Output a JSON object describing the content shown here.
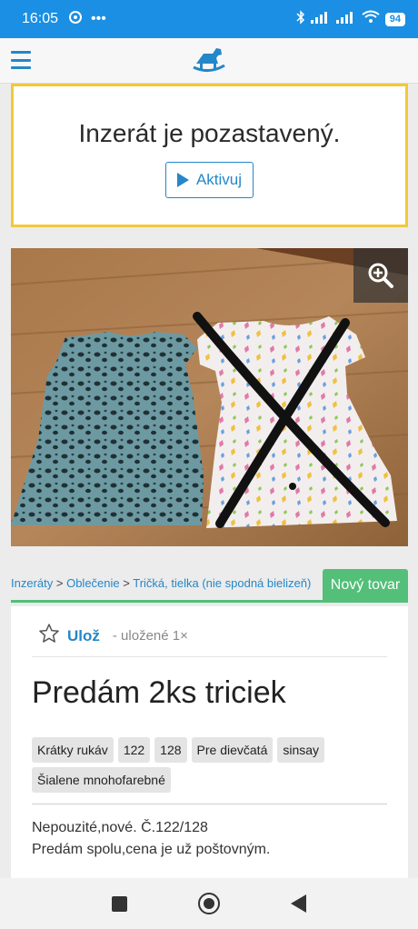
{
  "status_bar": {
    "time": "16:05",
    "battery": "94"
  },
  "paused": {
    "title": "Inzerát je pozastavený.",
    "activate_label": "Aktivuj"
  },
  "breadcrumb": {
    "items": [
      "Inzeráty",
      "Oblečenie",
      "Tričká, tielka (nie spodná bielizeň)"
    ],
    "separator": ">"
  },
  "badge": "Nový tovar",
  "save": {
    "label": "Ulož",
    "count_text": "- uložené 1×"
  },
  "listing": {
    "title": "Predám 2ks triciek",
    "tags": [
      "Krátky rukáv",
      "122",
      "128",
      "Pre dievčatá",
      "sinsay",
      "Šialene mnohofarebné"
    ],
    "description": [
      "Nepouzité,nové. Č.122/128",
      "Predám spolu,cena je už poštovným."
    ]
  },
  "colors": {
    "accent": "#2487c8",
    "status_bar": "#1a8fe3",
    "badge": "#53bf78",
    "paused_border": "#f0c93a"
  }
}
